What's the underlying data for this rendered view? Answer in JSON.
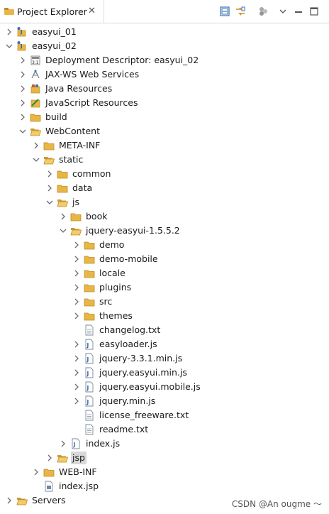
{
  "view": {
    "title": "Project Explorer",
    "close_glyph": "✕"
  },
  "toolbar": [
    "collapse-all-icon",
    "link-with-editor-icon",
    "filters-icon",
    "view-menu-icon",
    "minimize-icon",
    "maximize-icon"
  ],
  "tree": [
    {
      "label": "easyui_01",
      "depth": 0,
      "expander": "collapsed",
      "icon": "project"
    },
    {
      "label": "easyui_02",
      "depth": 0,
      "expander": "expanded",
      "icon": "project"
    },
    {
      "label": "Deployment Descriptor: easyui_02",
      "depth": 1,
      "expander": "collapsed",
      "icon": "deploy"
    },
    {
      "label": "JAX-WS Web Services",
      "depth": 1,
      "expander": "collapsed",
      "icon": "jaxws"
    },
    {
      "label": "Java Resources",
      "depth": 1,
      "expander": "collapsed",
      "icon": "javares"
    },
    {
      "label": "JavaScript Resources",
      "depth": 1,
      "expander": "collapsed",
      "icon": "jsres"
    },
    {
      "label": "build",
      "depth": 1,
      "expander": "collapsed",
      "icon": "folder"
    },
    {
      "label": "WebContent",
      "depth": 1,
      "expander": "expanded",
      "icon": "folder-open"
    },
    {
      "label": "META-INF",
      "depth": 2,
      "expander": "collapsed",
      "icon": "folder"
    },
    {
      "label": "static",
      "depth": 2,
      "expander": "expanded",
      "icon": "folder-open"
    },
    {
      "label": "common",
      "depth": 3,
      "expander": "collapsed",
      "icon": "folder"
    },
    {
      "label": "data",
      "depth": 3,
      "expander": "collapsed",
      "icon": "folder"
    },
    {
      "label": "js",
      "depth": 3,
      "expander": "expanded",
      "icon": "folder-open"
    },
    {
      "label": "book",
      "depth": 4,
      "expander": "collapsed",
      "icon": "folder"
    },
    {
      "label": "jquery-easyui-1.5.5.2",
      "depth": 4,
      "expander": "expanded",
      "icon": "folder-open"
    },
    {
      "label": "demo",
      "depth": 5,
      "expander": "collapsed",
      "icon": "folder"
    },
    {
      "label": "demo-mobile",
      "depth": 5,
      "expander": "collapsed",
      "icon": "folder"
    },
    {
      "label": "locale",
      "depth": 5,
      "expander": "collapsed",
      "icon": "folder"
    },
    {
      "label": "plugins",
      "depth": 5,
      "expander": "collapsed",
      "icon": "folder"
    },
    {
      "label": "src",
      "depth": 5,
      "expander": "collapsed",
      "icon": "folder"
    },
    {
      "label": "themes",
      "depth": 5,
      "expander": "collapsed",
      "icon": "folder"
    },
    {
      "label": "changelog.txt",
      "depth": 5,
      "expander": "none",
      "icon": "file"
    },
    {
      "label": "easyloader.js",
      "depth": 5,
      "expander": "collapsed",
      "icon": "jsfile"
    },
    {
      "label": "jquery-3.3.1.min.js",
      "depth": 5,
      "expander": "collapsed",
      "icon": "jsfile"
    },
    {
      "label": "jquery.easyui.min.js",
      "depth": 5,
      "expander": "collapsed",
      "icon": "jsfile"
    },
    {
      "label": "jquery.easyui.mobile.js",
      "depth": 5,
      "expander": "collapsed",
      "icon": "jsfile"
    },
    {
      "label": "jquery.min.js",
      "depth": 5,
      "expander": "collapsed",
      "icon": "jsfile"
    },
    {
      "label": "license_freeware.txt",
      "depth": 5,
      "expander": "none",
      "icon": "file"
    },
    {
      "label": "readme.txt",
      "depth": 5,
      "expander": "none",
      "icon": "file"
    },
    {
      "label": "index.js",
      "depth": 4,
      "expander": "collapsed",
      "icon": "jsfile"
    },
    {
      "label": "jsp",
      "depth": 3,
      "expander": "collapsed",
      "icon": "folder-open",
      "selected": true
    },
    {
      "label": "WEB-INF",
      "depth": 2,
      "expander": "collapsed",
      "icon": "folder"
    },
    {
      "label": "index.jsp",
      "depth": 2,
      "expander": "none",
      "icon": "jspfile"
    },
    {
      "label": "Servers",
      "depth": 0,
      "expander": "collapsed",
      "icon": "folder-open"
    }
  ],
  "watermark": "CSDN @An ougme ～",
  "colors": {
    "folder": "#e8b547",
    "folder_dark": "#c08a1e",
    "selection": "#d8d8d8",
    "chevron": "#6d6d6d",
    "java_blue": "#2a5fa8"
  }
}
